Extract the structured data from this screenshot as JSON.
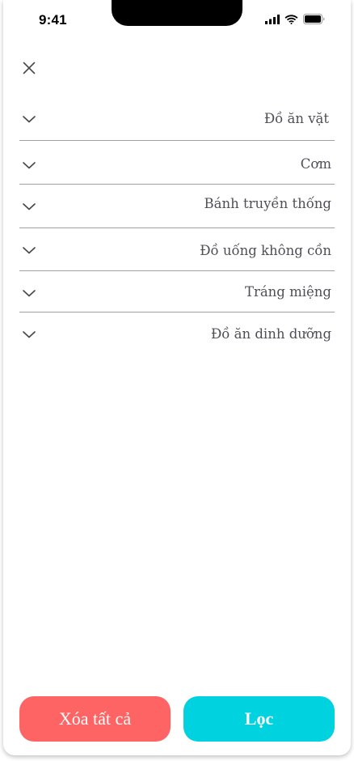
{
  "status_bar": {
    "time": "9:41",
    "icons": [
      "cellular-signal-icon",
      "wifi-icon",
      "battery-icon"
    ]
  },
  "header": {
    "close_icon": "close-icon"
  },
  "categories": [
    {
      "label": "Đồ ăn vặt"
    },
    {
      "label": "Cơm"
    },
    {
      "label": "Bánh truyền thống"
    },
    {
      "label": "Đồ uống không cồn"
    },
    {
      "label": "Tráng miệng"
    },
    {
      "label": "Đồ ăn dinh dưỡng"
    }
  ],
  "footer": {
    "clear_all_label": "Xóa tất cả",
    "filter_label": "Lọc"
  },
  "colors": {
    "clear_button": "#ff6464",
    "filter_button": "#00d2df",
    "label_text": "#4f4f58",
    "divider": "#a0a0a0"
  }
}
